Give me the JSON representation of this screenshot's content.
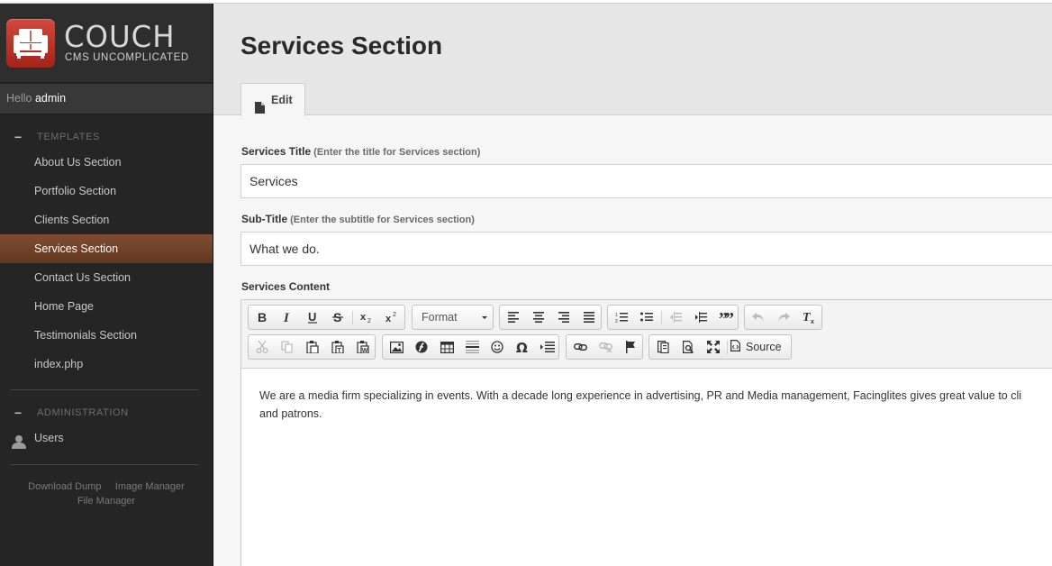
{
  "brand": {
    "name": "COUCH",
    "tagline": "CMS UNCOMPLICATED",
    "accent": "#c0392b"
  },
  "greeting": {
    "prefix": "Hello",
    "user": "admin"
  },
  "sidebar": {
    "templates_heading": "TEMPLATES",
    "items": [
      {
        "label": "About Us Section",
        "active": false
      },
      {
        "label": "Portfolio Section",
        "active": false
      },
      {
        "label": "Clients Section",
        "active": false
      },
      {
        "label": "Services Section",
        "active": true
      },
      {
        "label": "Contact Us Section",
        "active": false
      },
      {
        "label": "Home Page",
        "active": false
      },
      {
        "label": "Testimonials Section",
        "active": false
      },
      {
        "label": "index.php",
        "active": false
      }
    ],
    "admin_heading": "ADMINISTRATION",
    "admin_items": [
      {
        "label": "Users",
        "icon": "user-icon"
      }
    ],
    "footer": {
      "download_dump": "Download Dump",
      "image_manager": "Image Manager",
      "file_manager": "File Manager"
    }
  },
  "main": {
    "title": "Services Section",
    "tabs": [
      {
        "label": "Edit",
        "icon": "document-icon"
      }
    ],
    "fields": {
      "title": {
        "label": "Services Title",
        "hint": "(Enter the title for Services section)",
        "value": "Services"
      },
      "subtitle": {
        "label": "Sub-Title",
        "hint": "(Enter the subtitle for Services section)",
        "value": "What we do."
      },
      "content": {
        "label": "Services Content",
        "format_label": "Format",
        "source_label": "Source",
        "text_line1": "We are a media firm specializing in events. With a decade long experience in advertising, PR and Media management, Facinglites gives great value to cli",
        "text_line2": "and patrons."
      }
    }
  },
  "colors": {
    "sidebar_bg": "#252525",
    "active_item": "#6e412a",
    "header_bg": "#e6e6e6"
  }
}
